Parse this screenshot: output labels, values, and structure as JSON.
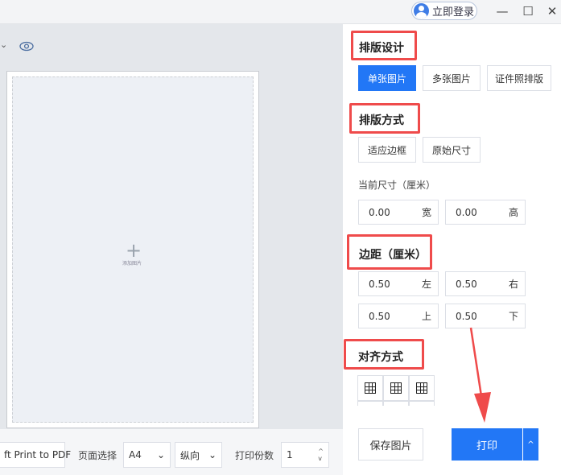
{
  "topbar": {
    "login_label": "立即登录",
    "icons": [
      "user-avatar-icon",
      "minimize-icon",
      "maximize-icon",
      "close-icon"
    ]
  },
  "toolbar": {
    "icons": [
      "chevron-down-icon",
      "eye-icon"
    ]
  },
  "canvas": {
    "add_image_label": "添加图片"
  },
  "bottom": {
    "printer": "ft Print to PDF",
    "page_label": "页面选择",
    "page_size": "A4",
    "orientation": "纵向",
    "copies_label": "打印份数",
    "copies": "1"
  },
  "panel": {
    "layout_design": {
      "title": "排版设计",
      "options": [
        "单张图片",
        "多张图片",
        "证件照排版"
      ],
      "selected": "单张图片"
    },
    "layout_mode": {
      "title": "排版方式",
      "options": [
        "适应边框",
        "原始尺寸"
      ]
    },
    "size": {
      "label": "当前尺寸（厘米）",
      "width": "0.00",
      "width_unit": "宽",
      "height": "0.00",
      "height_unit": "高"
    },
    "margin": {
      "title": "边距（厘米）",
      "left": "0.50",
      "left_label": "左",
      "right": "0.50",
      "right_label": "右",
      "top": "0.50",
      "top_label": "上",
      "bottom": "0.50",
      "bottom_label": "下"
    },
    "align": {
      "title": "对齐方式"
    },
    "save_label": "保存图片",
    "print_label": "打印"
  },
  "colors": {
    "accent": "#2277f6",
    "annotation": "#ef4b4b"
  }
}
